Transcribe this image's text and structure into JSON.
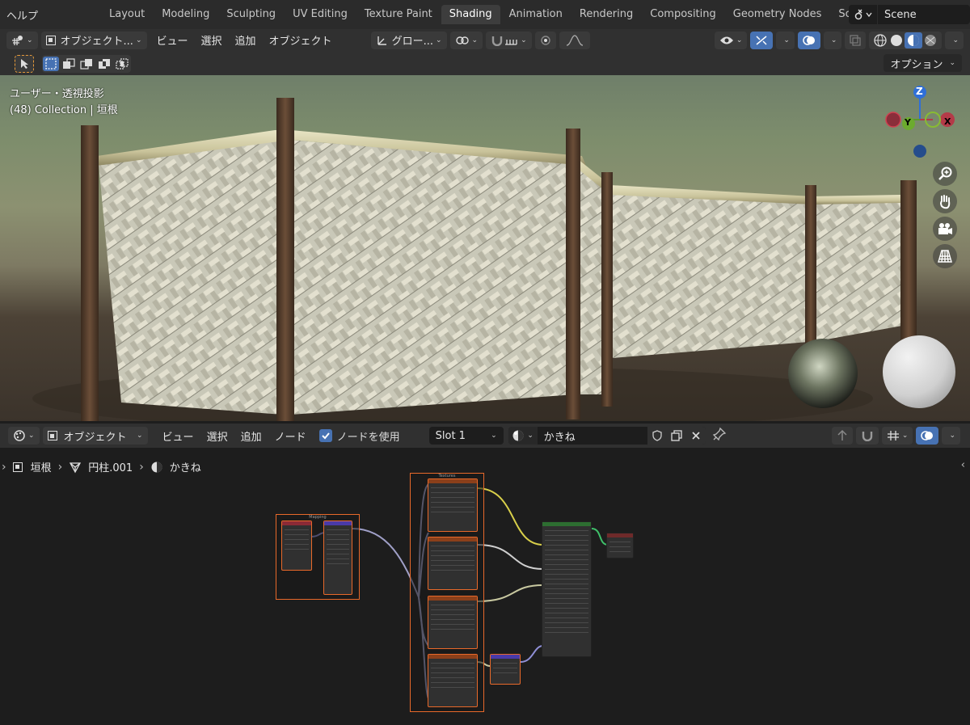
{
  "topbar": {
    "menu_help": "ヘルプ",
    "tabs": [
      "Layout",
      "Modeling",
      "Sculpting",
      "UV Editing",
      "Texture Paint",
      "Shading",
      "Animation",
      "Rendering",
      "Compositing",
      "Geometry Nodes",
      "Scripting"
    ],
    "active_tab": "Shading",
    "add_tab_symbol": "+",
    "scene_name": "Scene"
  },
  "viewport_header": {
    "mode": "オブジェクト...",
    "menus": [
      "ビュー",
      "選択",
      "追加",
      "オブジェクト"
    ],
    "transform_orientation": "グロー...",
    "options_label": "オプション"
  },
  "viewport": {
    "view_label": "ユーザー・透視投影",
    "collection_label": "(48) Collection | 垣根",
    "axis_labels": {
      "z": "Z",
      "y": "Y",
      "x": "X"
    }
  },
  "shader_header": {
    "mode": "オブジェクト",
    "menus": [
      "ビュー",
      "選択",
      "追加",
      "ノード"
    ],
    "use_nodes_label": "ノードを使用",
    "use_nodes_checked": true,
    "slot": "Slot 1",
    "material_name": "かきね"
  },
  "breadcrumb": {
    "object": "垣根",
    "mesh": "円柱.001",
    "material": "かきね"
  },
  "nodes": {
    "mapping_frame_title": "Mapping",
    "textures_frame_title": "Textures"
  },
  "colors": {
    "accent": "#4772b3",
    "frame_border": "#e8692a",
    "bsdf_header": "#2d6e31",
    "texture_header": "#8b3f1a",
    "mapping_header": "#6a3a78",
    "output_header": "#6e2a2a"
  }
}
